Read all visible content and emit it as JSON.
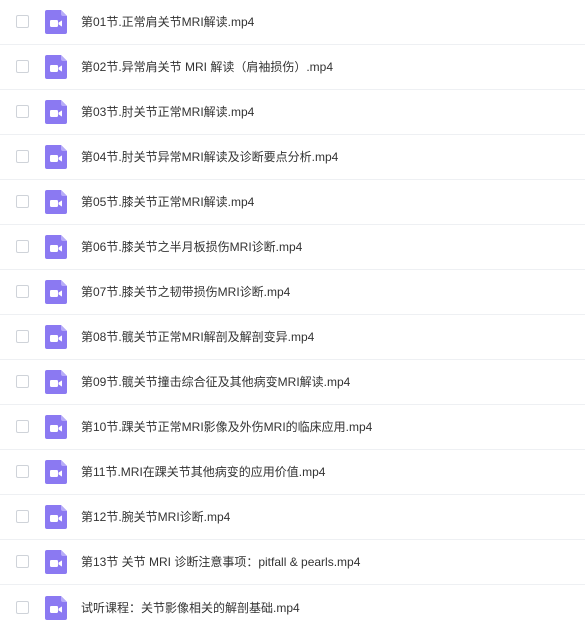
{
  "colors": {
    "icon_bg": "#8b79f2",
    "icon_fold": "#b7acf8",
    "icon_glyph": "#ffffff",
    "divider": "#eef0f3",
    "text": "#333333"
  },
  "files": [
    {
      "icon": "video-file-icon",
      "name": "第01节.正常肩关节MRI解读.mp4"
    },
    {
      "icon": "video-file-icon",
      "name": "第02节.异常肩关节 MRI 解读（肩袖损伤）.mp4"
    },
    {
      "icon": "video-file-icon",
      "name": "第03节.肘关节正常MRI解读.mp4"
    },
    {
      "icon": "video-file-icon",
      "name": "第04节.肘关节异常MRI解读及诊断要点分析.mp4"
    },
    {
      "icon": "video-file-icon",
      "name": "第05节.膝关节正常MRI解读.mp4"
    },
    {
      "icon": "video-file-icon",
      "name": "第06节.膝关节之半月板损伤MRI诊断.mp4"
    },
    {
      "icon": "video-file-icon",
      "name": "第07节.膝关节之韧带损伤MRI诊断.mp4"
    },
    {
      "icon": "video-file-icon",
      "name": "第08节.髋关节正常MRI解剖及解剖变异.mp4"
    },
    {
      "icon": "video-file-icon",
      "name": "第09节.髋关节撞击综合征及其他病变MRI解读.mp4"
    },
    {
      "icon": "video-file-icon",
      "name": "第10节.踝关节正常MRI影像及外伤MRI的临床应用.mp4"
    },
    {
      "icon": "video-file-icon",
      "name": "第11节.MRI在踝关节其他病变的应用价值.mp4"
    },
    {
      "icon": "video-file-icon",
      "name": "第12节.腕关节MRI诊断.mp4"
    },
    {
      "icon": "video-file-icon",
      "name": "第13节 关节 MRI 诊断注意事项：pitfall & pearls.mp4"
    },
    {
      "icon": "video-file-icon",
      "name": "试听课程：关节影像相关的解剖基础.mp4"
    }
  ]
}
